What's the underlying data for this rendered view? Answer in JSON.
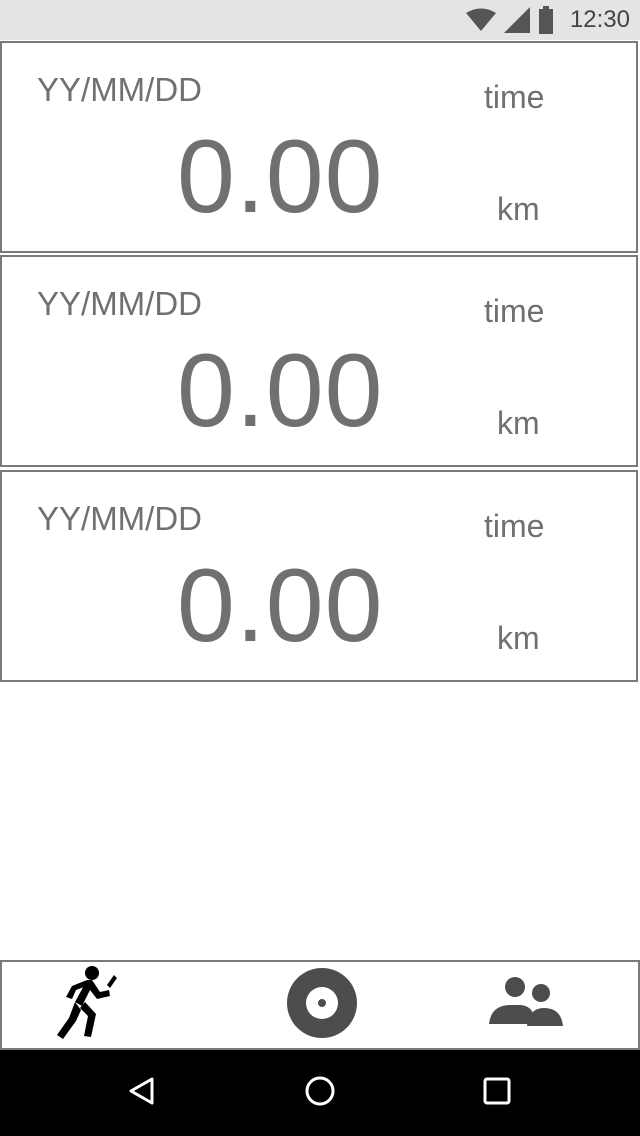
{
  "status_bar": {
    "time": "12:30",
    "icons": [
      "wifi-icon",
      "cell-signal-icon",
      "battery-icon"
    ]
  },
  "runs": [
    {
      "date": "YY/MM/DD",
      "time_label": "time",
      "distance": "0.00",
      "unit": "km"
    },
    {
      "date": "YY/MM/DD",
      "time_label": "time",
      "distance": "0.00",
      "unit": "km"
    },
    {
      "date": "YY/MM/DD",
      "time_label": "time",
      "distance": "0.00",
      "unit": "km"
    }
  ],
  "tab_bar": {
    "tabs": [
      {
        "icon": "running-person-icon"
      },
      {
        "icon": "record-disc-icon"
      },
      {
        "icon": "people-icon"
      }
    ]
  },
  "nav_bar": {
    "buttons": [
      "back-triangle-icon",
      "home-circle-icon",
      "recents-square-icon"
    ]
  },
  "colors": {
    "status_bar_bg": "#e4e4e4",
    "text_gray": "#707070",
    "border_gray": "#7a7a7a",
    "nav_bar_bg": "#000000",
    "icon_dark": "#4d4d4d"
  }
}
